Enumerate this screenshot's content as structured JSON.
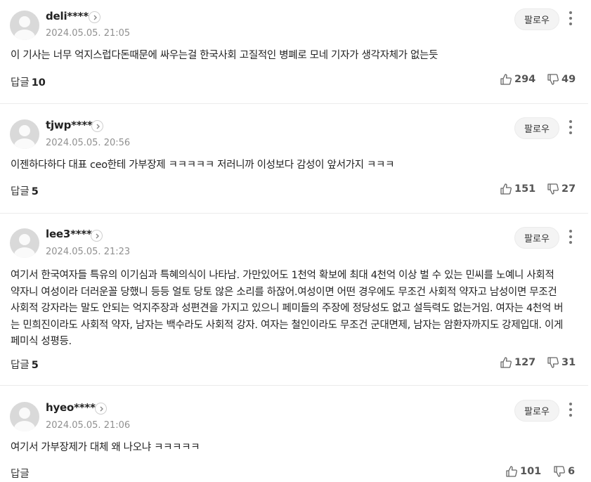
{
  "follow_label": "팔로우",
  "reply_label": "답글",
  "comments": [
    {
      "username": "deli****",
      "date": "2024.05.05. 21:05",
      "text": "이 기사는 너무 억지스럽다돈때문에 싸우는걸 한국사회 고질적인 병폐로 모네 기자가 생각자체가 없는듯",
      "replies": "10",
      "likes": "294",
      "dislikes": "49"
    },
    {
      "username": "tjwp****",
      "date": "2024.05.05. 20:56",
      "text": "이젠하다하다 대표 ceo한테 가부장제 ㅋㅋㅋㅋㅋ 저러니까 이성보다 감성이 앞서가지 ㅋㅋㅋ",
      "replies": "5",
      "likes": "151",
      "dislikes": "27"
    },
    {
      "username": "lee3****",
      "date": "2024.05.05. 21:23",
      "text": "여기서 한국여자들 특유의 이기심과 특혜의식이 나타남. 가만있어도 1천억 확보에 최대 4천억 이상 벌 수 있는 민씨를 노예니 사회적 약자니 여성이라 더러운꼴 당했니 등등 얼토 당토 않은 소리를 하잖어.여성이면 어떤 경우에도 무조건 사회적 약자고 남성이면 무조건 사회적 강자라는 말도 안되는 억지주장과 성편견을 가지고 있으니 페미들의 주장에 정당성도 없고 설득력도 없는거임. 여자는 4천억 버는 민희진이라도 사회적 약자, 남자는 백수라도 사회적 강자. 여자는 철인이라도 무조건 군대면제, 남자는 암환자까지도 강제입대. 이게 페미식 성평등.",
      "replies": "5",
      "likes": "127",
      "dislikes": "31"
    },
    {
      "username": "hyeo****",
      "date": "2024.05.05. 21:06",
      "text": "여기서 가부장제가 대체 왜 나오냐 ㅋㅋㅋㅋㅋ",
      "replies": "",
      "likes": "101",
      "dislikes": "6"
    }
  ]
}
